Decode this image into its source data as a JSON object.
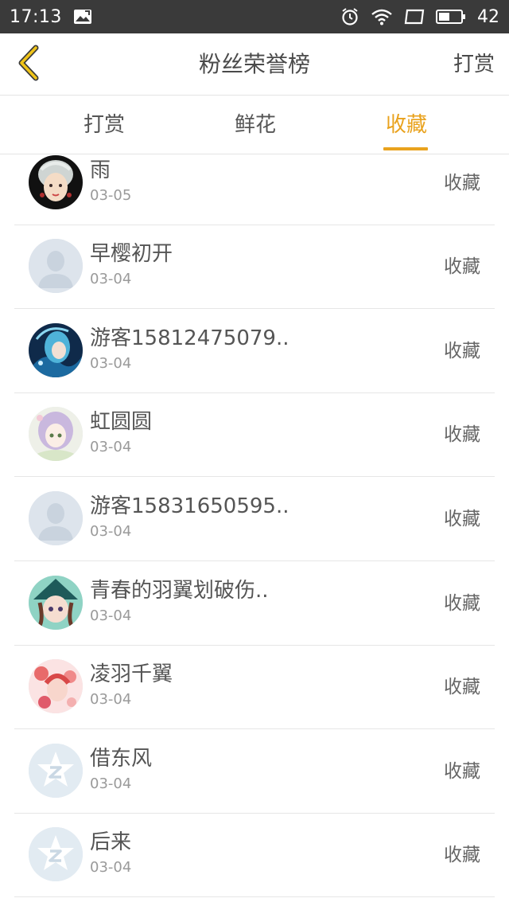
{
  "status_bar": {
    "time": "17:13",
    "battery": "42",
    "icons": [
      "image-notification-icon",
      "alarm-icon",
      "wifi-icon",
      "screen-icon",
      "battery-icon"
    ]
  },
  "header": {
    "back_icon": "chevron-left-icon",
    "title": "粉丝荣誉榜",
    "action": "打赏"
  },
  "tabs": [
    {
      "label": "打赏",
      "active": false
    },
    {
      "label": "鲜花",
      "active": false
    },
    {
      "label": "收藏",
      "active": true
    }
  ],
  "colors": {
    "accent": "#e9a21d",
    "status_bar": "#3a3a3a",
    "text": "#555555",
    "subtext": "#9a9a9a",
    "divider": "#e6e6e6"
  },
  "fans": [
    {
      "name": "雨",
      "date": "03-05",
      "action": "收藏",
      "avatar": "painted-portrait-avatar"
    },
    {
      "name": "早樱初开",
      "date": "03-04",
      "action": "收藏",
      "avatar": "default-person-avatar"
    },
    {
      "name": "游客15812475079..",
      "date": "03-04",
      "action": "收藏",
      "avatar": "anime-blue-hair-avatar"
    },
    {
      "name": "虹圆圆",
      "date": "03-04",
      "action": "收藏",
      "avatar": "anime-lavender-hair-avatar"
    },
    {
      "name": "游客15831650595..",
      "date": "03-04",
      "action": "收藏",
      "avatar": "default-person-avatar"
    },
    {
      "name": "青春的羽翼划破伤..",
      "date": "03-04",
      "action": "收藏",
      "avatar": "anime-witch-hat-avatar"
    },
    {
      "name": "凌羽千翼",
      "date": "03-04",
      "action": "收藏",
      "avatar": "anime-red-flowers-avatar"
    },
    {
      "name": "借东风",
      "date": "03-04",
      "action": "收藏",
      "avatar": "qzone-star-avatar"
    },
    {
      "name": "后来",
      "date": "03-04",
      "action": "收藏",
      "avatar": "qzone-star-avatar"
    }
  ]
}
